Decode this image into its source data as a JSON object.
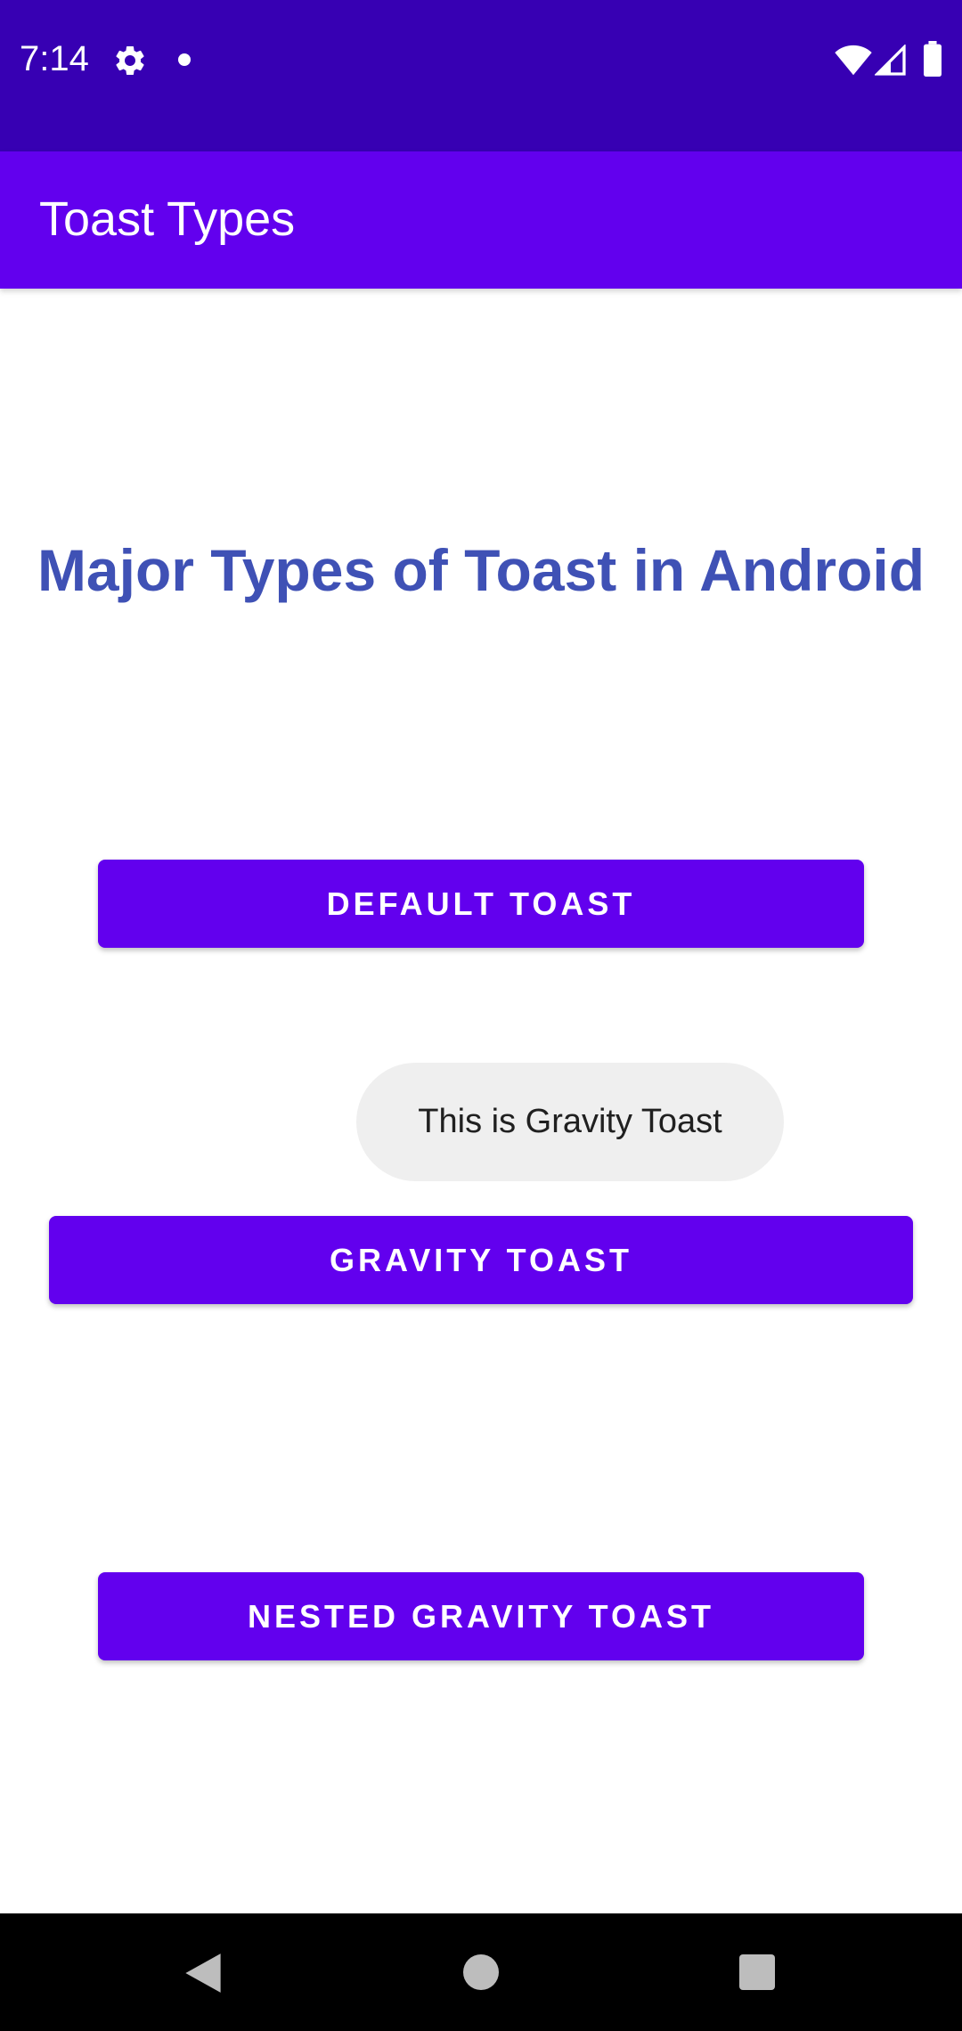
{
  "status_bar": {
    "time": "7:14",
    "icons": [
      "gear-icon",
      "notification-dot-icon",
      "wifi-icon",
      "cell-signal-icon",
      "battery-icon"
    ],
    "background_color": "#3700b3"
  },
  "app_bar": {
    "title": "Toast Types",
    "background_color": "#6200ee"
  },
  "main": {
    "heading": "Major Types of Toast in Android",
    "heading_color": "#3f51b5",
    "buttons": {
      "default_label": "DEFAULT TOAST",
      "gravity_label": "GRAVITY TOAST",
      "nested_label": "NESTED GRAVITY TOAST"
    },
    "button_color": "#6200ee"
  },
  "toast": {
    "message": "This is Gravity Toast"
  },
  "nav_bar": {
    "icons": [
      "back-icon",
      "home-icon",
      "recents-icon"
    ]
  }
}
